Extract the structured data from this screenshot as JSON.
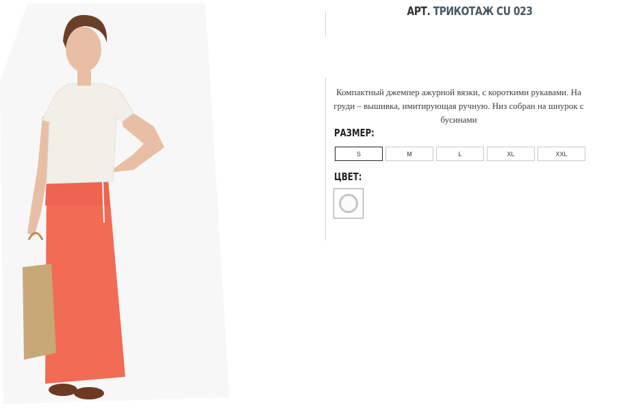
{
  "product": {
    "title_prefix": "АРТ.",
    "title_name": "ТРИКОТАЖ CU 023",
    "description": "Компактный джемпер ажурной вязки, с короткими рукавами. На груди – вышивка, имитирующая ручную. Низ собран на шнурок с бусинами"
  },
  "size_section": {
    "label": "РАЗМЕР:",
    "options": [
      "S",
      "M",
      "L",
      "XL",
      "XXL"
    ],
    "selected": "S"
  },
  "color_section": {
    "label": "ЦВЕТ:",
    "swatches": [
      {
        "name": "white",
        "color": "#ffffff"
      }
    ]
  },
  "colors": {
    "skirt": "#f26b55",
    "top": "#f2eee8",
    "bag": "#c9a877",
    "shoes": "#6b3a22",
    "skin": "#e8bfa5",
    "hair": "#6a3f28"
  }
}
